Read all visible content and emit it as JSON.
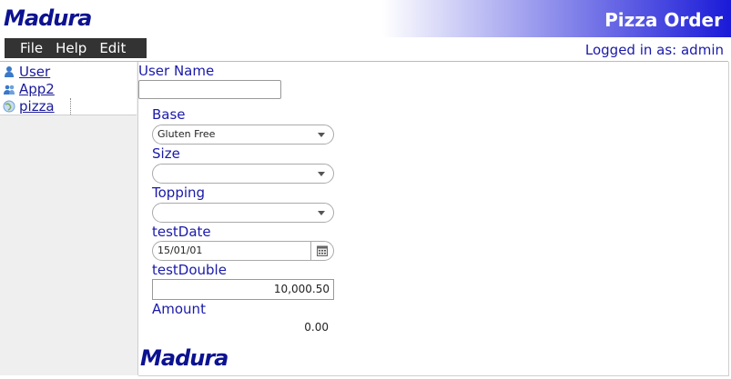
{
  "header": {
    "logo": "Madura",
    "title": "Pizza Order"
  },
  "menu": {
    "items": [
      "File",
      "Help",
      "Edit"
    ]
  },
  "session": {
    "logged_in": "Logged in as: admin"
  },
  "tree": {
    "items": [
      {
        "label": "User",
        "icon": "user-icon"
      },
      {
        "label": "App2",
        "icon": "users-icon"
      },
      {
        "label": "pizza",
        "icon": "globe-icon"
      }
    ]
  },
  "form": {
    "user_name": {
      "label": "User Name",
      "value": ""
    },
    "base": {
      "label": "Base",
      "value": "Gluten Free"
    },
    "size": {
      "label": "Size",
      "value": ""
    },
    "topping": {
      "label": "Topping",
      "value": ""
    },
    "test_date": {
      "label": "testDate",
      "value": "15/01/01"
    },
    "test_double": {
      "label": "testDouble",
      "value": "10,000.50"
    },
    "amount": {
      "label": "Amount",
      "value": "0.00"
    }
  },
  "footer": {
    "logo": "Madura"
  },
  "colors": {
    "accent": "#1a1aaa",
    "logo": "#0c1290",
    "menubar": "#333333"
  }
}
